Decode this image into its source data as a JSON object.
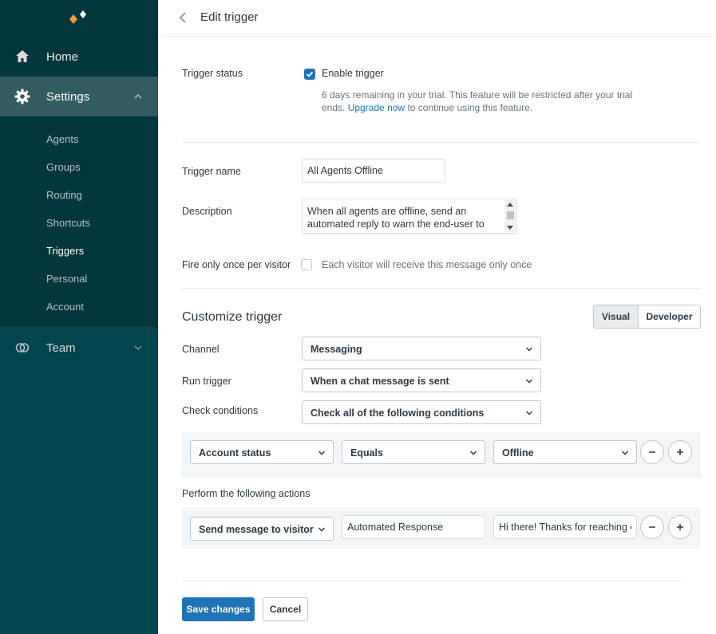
{
  "sidebar": {
    "nav": [
      {
        "label": "Home",
        "icon": "home-icon"
      },
      {
        "label": "Settings",
        "icon": "gear-icon"
      },
      {
        "label": "Team",
        "icon": "team-icon"
      }
    ],
    "settings_items": [
      {
        "label": "Agents"
      },
      {
        "label": "Groups"
      },
      {
        "label": "Routing"
      },
      {
        "label": "Shortcuts"
      },
      {
        "label": "Triggers",
        "active": true
      },
      {
        "label": "Personal"
      },
      {
        "label": "Account"
      }
    ]
  },
  "header": {
    "title": "Edit trigger"
  },
  "form": {
    "status": {
      "label": "Trigger status",
      "checkbox_label": "Enable trigger",
      "checked": true,
      "hint_before": "6 days remaining in your trial. This feature will be restricted after your trial ends.",
      "hint_link": "Upgrade now",
      "hint_after": "to continue using this feature."
    },
    "name": {
      "label": "Trigger name",
      "value": "All Agents Offline"
    },
    "description": {
      "label": "Description",
      "value": "When all agents are offline, send an automated reply to warn the end-user to"
    },
    "fire_once": {
      "label": "Fire only once per visitor",
      "checkbox_label": "Each visitor will receive this message only once",
      "checked": false
    },
    "customize": {
      "title": "Customize trigger",
      "modes": [
        "Visual",
        "Developer"
      ],
      "selected_mode": "Visual",
      "channel": {
        "label": "Channel",
        "value": "Messaging"
      },
      "run_trigger": {
        "label": "Run trigger",
        "value": "When a chat message is sent"
      },
      "check_conditions": {
        "label": "Check conditions",
        "value": "Check all of the following conditions"
      },
      "condition": {
        "field": "Account status",
        "operator": "Equals",
        "value": "Offline"
      },
      "actions_label": "Perform the following actions",
      "action": {
        "type": "Send message to visitor",
        "name": "Automated Response",
        "message": "Hi there! Thanks for reaching out"
      }
    }
  },
  "buttons": {
    "save": "Save changes",
    "cancel": "Cancel"
  },
  "colors": {
    "sidebar_bg": "#03363d",
    "sidebar_active": "#325c62",
    "primary": "#1f73b7",
    "logo_orange": "#f79a3e"
  }
}
